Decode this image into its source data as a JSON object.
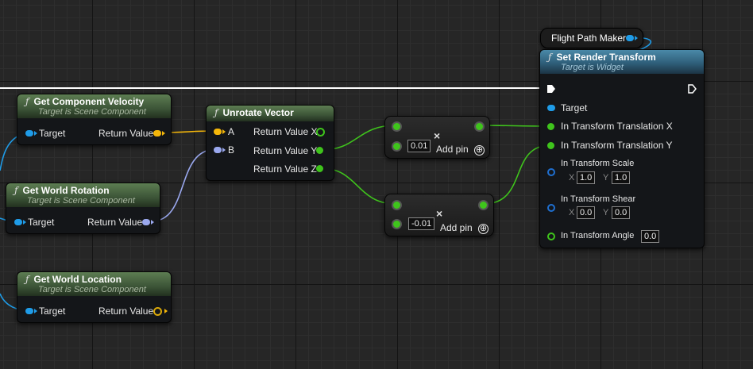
{
  "colors": {
    "background": "#262626",
    "node_body": "#141619",
    "pure_header": "#3c5437",
    "impure_header": "#2f5f7a",
    "object_pin": "#1f9ce8",
    "vector_pin": "#f5b70a",
    "rotator_pin": "#9aa8ee",
    "float_pin": "#3fc41c",
    "exec_wire": "#ffffff"
  },
  "nodes": {
    "get_component_velocity": {
      "icon": "function-icon",
      "title": "Get Component Velocity",
      "subtitle": "Target is Scene Component",
      "input": "Target",
      "output": "Return Value"
    },
    "get_world_rotation": {
      "icon": "function-icon",
      "title": "Get World Rotation",
      "subtitle": "Target is Scene Component",
      "input": "Target",
      "output": "Return Value"
    },
    "get_world_location": {
      "icon": "function-icon",
      "title": "Get World Location",
      "subtitle": "Target is Scene Component",
      "input": "Target",
      "output": "Return Value"
    },
    "unrotate_vector": {
      "icon": "function-icon",
      "title": "Unrotate Vector",
      "input_a": "A",
      "input_b": "B",
      "output_x": "Return Value X",
      "output_y": "Return Value Y",
      "output_z": "Return Value Z"
    },
    "multiply_1": {
      "operator": "×",
      "value": "0.01",
      "add_pin": "Add pin",
      "add_pin_icon": "⊕"
    },
    "multiply_2": {
      "operator": "×",
      "value": "-0.01",
      "add_pin": "Add pin",
      "add_pin_icon": "⊕"
    },
    "flight_path_maker": {
      "title": "Flight Path Maker"
    },
    "set_render_transform": {
      "icon": "function-icon",
      "title": "Set Render Transform",
      "subtitle": "Target is Widget",
      "target": "Target",
      "translation_x": "In Transform Translation X",
      "translation_y": "In Transform Translation Y",
      "scale_label": "In Transform Scale",
      "scale_x_axis": "X",
      "scale_x": "1.0",
      "scale_y_axis": "Y",
      "scale_y": "1.0",
      "shear_label": "In Transform Shear",
      "shear_x_axis": "X",
      "shear_x": "0.0",
      "shear_y_axis": "Y",
      "shear_y": "0.0",
      "angle_label": "In Transform Angle",
      "angle": "0.0"
    }
  }
}
